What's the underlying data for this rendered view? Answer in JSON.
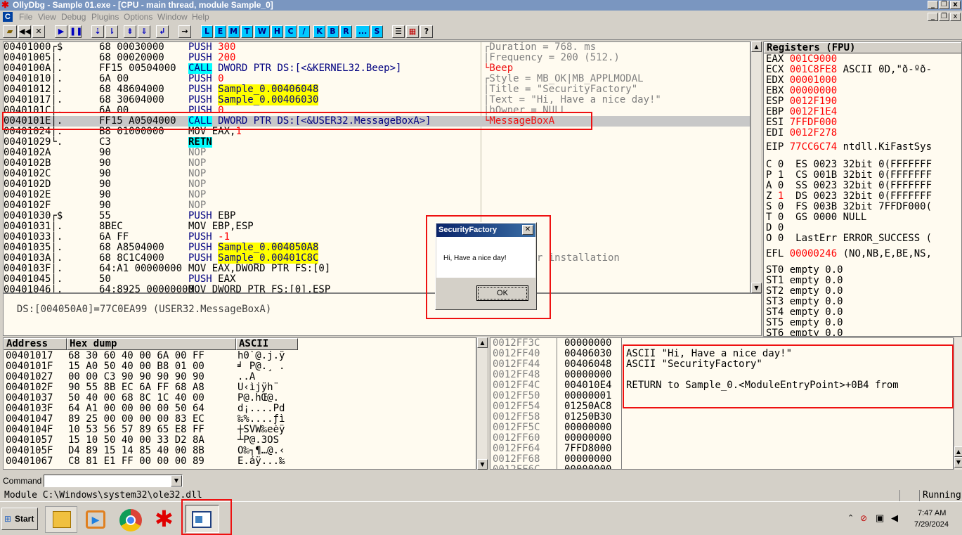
{
  "window": {
    "title": "OllyDbg - Sample 01.exe - [CPU - main thread, module Sample_0]"
  },
  "menu": [
    "File",
    "View",
    "Debug",
    "Plugins",
    "Options",
    "Window",
    "Help"
  ],
  "toolbar": {
    "letters": [
      "L",
      "E",
      "M",
      "T",
      "W",
      "H",
      "C",
      "/",
      "K",
      "B",
      "R",
      "...",
      "S"
    ]
  },
  "disasm": {
    "rows": [
      {
        "addr": "00401000",
        "mark": "┌$",
        "hex": "68 00030000",
        "op": "PUSH",
        "arg": "300",
        "style": "push"
      },
      {
        "addr": "00401005",
        "mark": "│.",
        "hex": "68 00020000",
        "op": "PUSH",
        "arg": "200",
        "style": "push"
      },
      {
        "addr": "0040100A",
        "mark": "│.",
        "hex": "FF15 00504000",
        "op": "CALL",
        "arg": "DWORD PTR DS:[<&KERNEL32.Beep>]",
        "style": "call"
      },
      {
        "addr": "00401010",
        "mark": "│.",
        "hex": "6A 00",
        "op": "PUSH",
        "arg": "0",
        "style": "push"
      },
      {
        "addr": "00401012",
        "mark": "│.",
        "hex": "68 48604000",
        "op": "PUSH",
        "arg": "Sample_0.00406048",
        "style": "pushy"
      },
      {
        "addr": "00401017",
        "mark": "│.",
        "hex": "68 30604000",
        "op": "PUSH",
        "arg": "Sample_0.00406030",
        "style": "pushy"
      },
      {
        "addr": "0040101C",
        "mark": "│.",
        "hex": "6A 00",
        "op": "PUSH",
        "arg": "0",
        "style": "push"
      },
      {
        "addr": "0040101E",
        "mark": "│.",
        "hex": "FF15 A0504000",
        "op": "CALL",
        "arg": "DWORD PTR DS:[<&USER32.MessageBoxA>]",
        "style": "callsel"
      },
      {
        "addr": "00401024",
        "mark": "│.",
        "hex": "B8 01000000",
        "op": "MOV EAX,",
        "arg": "1",
        "style": "mov"
      },
      {
        "addr": "00401029",
        "mark": "└.",
        "hex": "C3",
        "op": "RETN",
        "arg": "",
        "style": "retn"
      },
      {
        "addr": "0040102A",
        "mark": "",
        "hex": "90",
        "op": "NOP",
        "arg": "",
        "style": "nop"
      },
      {
        "addr": "0040102B",
        "mark": "",
        "hex": "90",
        "op": "NOP",
        "arg": "",
        "style": "nop"
      },
      {
        "addr": "0040102C",
        "mark": "",
        "hex": "90",
        "op": "NOP",
        "arg": "",
        "style": "nop"
      },
      {
        "addr": "0040102D",
        "mark": "",
        "hex": "90",
        "op": "NOP",
        "arg": "",
        "style": "nop"
      },
      {
        "addr": "0040102E",
        "mark": "",
        "hex": "90",
        "op": "NOP",
        "arg": "",
        "style": "nop"
      },
      {
        "addr": "0040102F",
        "mark": "",
        "hex": "90",
        "op": "NOP",
        "arg": "",
        "style": "nop"
      },
      {
        "addr": "00401030",
        "mark": "┌$",
        "hex": "55",
        "op": "PUSH",
        "arg": "EBP",
        "style": "pushplain"
      },
      {
        "addr": "00401031",
        "mark": "│.",
        "hex": "8BEC",
        "op": "MOV EBP,ESP",
        "arg": "",
        "style": "plain"
      },
      {
        "addr": "00401033",
        "mark": "│.",
        "hex": "6A FF",
        "op": "PUSH",
        "arg": "-1",
        "style": "push"
      },
      {
        "addr": "00401035",
        "mark": "│.",
        "hex": "68 A8504000",
        "op": "PUSH",
        "arg": "Sample_0.004050A8",
        "style": "pushy"
      },
      {
        "addr": "0040103A",
        "mark": "│.",
        "hex": "68 8C1C4000",
        "op": "PUSH",
        "arg": "Sample_0.00401C8C",
        "style": "pushy"
      },
      {
        "addr": "0040103F",
        "mark": "│.",
        "hex": "64:A1 00000000",
        "op": "MOV EAX,DWORD PTR FS:[0]",
        "arg": "",
        "style": "plain"
      },
      {
        "addr": "00401045",
        "mark": "│.",
        "hex": "50",
        "op": "PUSH",
        "arg": "EAX",
        "style": "pushplain"
      },
      {
        "addr": "00401046",
        "mark": "│.",
        "hex": "64:8925 00000000",
        "op": "MOV DWORD PTR FS:[0],ESP",
        "arg": "",
        "style": "plain"
      }
    ],
    "comments": [
      {
        "row": 0,
        "text": "┌Duration = 768. ms",
        "c": "gray"
      },
      {
        "row": 1,
        "text": "│Frequency = 200 (512.)",
        "c": "gray"
      },
      {
        "row": 2,
        "text": "└Beep",
        "c": "red"
      },
      {
        "row": 3,
        "text": "┌Style = MB_OK|MB_APPLMODAL",
        "c": "gray"
      },
      {
        "row": 4,
        "text": "│Title = \"SecurityFactory\"",
        "c": "gray"
      },
      {
        "row": 5,
        "text": "│Text = \"Hi, Have a nice day!\"",
        "c": "gray"
      },
      {
        "row": 6,
        "text": "│hOwner = NULL",
        "c": "gray"
      },
      {
        "row": 7,
        "text": "└MessageBoxA",
        "c": "red"
      },
      {
        "row": 20,
        "text": "SE handler installation",
        "c": "gray"
      }
    ],
    "info": "DS:[004050A0]=77C0EA99 (USER32.MessageBoxA)"
  },
  "registers": {
    "header": "Registers (FPU)",
    "gp": [
      {
        "n": "EAX",
        "v": "001C9000",
        "x": ""
      },
      {
        "n": "ECX",
        "v": "001C8FE8",
        "x": "ASCII 0D,\"ð-ºð-"
      },
      {
        "n": "EDX",
        "v": "00001000",
        "x": ""
      },
      {
        "n": "EBX",
        "v": "00000000",
        "x": ""
      },
      {
        "n": "ESP",
        "v": "0012F190",
        "x": ""
      },
      {
        "n": "EBP",
        "v": "0012F1E4",
        "x": ""
      },
      {
        "n": "ESI",
        "v": "7FFDF000",
        "x": ""
      },
      {
        "n": "EDI",
        "v": "0012F278",
        "x": ""
      }
    ],
    "eip": {
      "n": "EIP",
      "v": "77CC6C74",
      "x": "ntdll.KiFastSys"
    },
    "flags": [
      {
        "f": "C",
        "b": "0",
        "s": "ES 0023 32bit 0(FFFFFFF",
        "red": false
      },
      {
        "f": "P",
        "b": "1",
        "s": "CS 001B 32bit 0(FFFFFFF",
        "red": false
      },
      {
        "f": "A",
        "b": "0",
        "s": "SS 0023 32bit 0(FFFFFFF",
        "red": false
      },
      {
        "f": "Z",
        "b": "1",
        "s": "DS 0023 32bit 0(FFFFFFF",
        "red": true
      },
      {
        "f": "S",
        "b": "0",
        "s": "FS 003B 32bit 7FFDF000(",
        "red": false
      },
      {
        "f": "T",
        "b": "0",
        "s": "GS 0000 NULL",
        "red": false
      },
      {
        "f": "D",
        "b": "0",
        "s": "",
        "red": false
      },
      {
        "f": "O",
        "b": "0",
        "s": "LastErr ERROR_SUCCESS (",
        "red": false
      }
    ],
    "efl": {
      "n": "EFL",
      "v": "00000246",
      "x": "(NO,NB,E,BE,NS,"
    },
    "fpu": [
      "ST0 empty 0.0",
      "ST1 empty 0.0",
      "ST2 empty 0.0",
      "ST3 empty 0.0",
      "ST4 empty 0.0",
      "ST5 empty 0.0",
      "ST6 empty 0.0"
    ]
  },
  "dump": {
    "headers": {
      "address": "Address",
      "hex": "Hex dump",
      "ascii": "ASCII"
    },
    "rows": [
      {
        "a": "00401017",
        "h": "68 30 60 40 00 6A 00 FF",
        "s": "h0`@.j.ÿ"
      },
      {
        "a": "0040101F",
        "h": "15 A0 50 40 00 B8 01 00",
        "s": "╛ P@.¸ ."
      },
      {
        "a": "00401027",
        "h": "00 00 C3 90 90 90 90 90",
        "s": "..Ã"
      },
      {
        "a": "0040102F",
        "h": "90 55 8B EC 6A FF 68 A8",
        "s": "U‹ìjÿh¨"
      },
      {
        "a": "00401037",
        "h": "50 40 00 68 8C 1C 40 00",
        "s": "P@.hŒ@."
      },
      {
        "a": "0040103F",
        "h": "64 A1 00 00 00 00 50 64",
        "s": "d¡....Pd"
      },
      {
        "a": "00401047",
        "h": "89 25 00 00 00 00 83 EC",
        "s": "‰%....ƒì"
      },
      {
        "a": "0040104F",
        "h": "10 53 56 57 89 65 E8 FF",
        "s": "┼SVW‰eèÿ"
      },
      {
        "a": "00401057",
        "h": "15 10 50 40 00 33 D2 8A",
        "s": "┴P@.3ÒŠ"
      },
      {
        "a": "0040105F",
        "h": "D4 89 15 14 85 40 00 8B",
        "s": "Ô‰┐¶…@.‹"
      },
      {
        "a": "00401067",
        "h": "C8 81 E1 FF 00 00 00 89",
        "s": "È.áÿ...‰"
      }
    ]
  },
  "stack": {
    "rows": [
      {
        "a": "0012FF3C",
        "v": "00000000",
        "c": ""
      },
      {
        "a": "0012FF40",
        "v": "00406030",
        "c": "ASCII \"Hi, Have a nice day!\""
      },
      {
        "a": "0012FF44",
        "v": "00406048",
        "c": "ASCII \"SecurityFactory\""
      },
      {
        "a": "0012FF48",
        "v": "00000000",
        "c": ""
      },
      {
        "a": "0012FF4C",
        "v": "004010E4",
        "c": "RETURN to Sample_0.<ModuleEntryPoint>+0B4 from"
      },
      {
        "a": "0012FF50",
        "v": "00000001",
        "c": ""
      },
      {
        "a": "0012FF54",
        "v": "01250AC8",
        "c": ""
      },
      {
        "a": "0012FF58",
        "v": "01250B30",
        "c": ""
      },
      {
        "a": "0012FF5C",
        "v": "00000000",
        "c": ""
      },
      {
        "a": "0012FF60",
        "v": "00000000",
        "c": ""
      },
      {
        "a": "0012FF64",
        "v": "7FFD8000",
        "c": ""
      },
      {
        "a": "0012FF68",
        "v": "00000000",
        "c": ""
      },
      {
        "a": "0012FF6C",
        "v": "00000000",
        "c": ""
      }
    ]
  },
  "dialog": {
    "title": "SecurityFactory",
    "message": "Hi, Have a nice day!",
    "ok": "OK"
  },
  "command": {
    "label": "Command :",
    "value": ""
  },
  "status": {
    "module": "Module C:\\Windows\\system32\\ole32.dll",
    "state": "Running"
  },
  "taskbar": {
    "start": "Start",
    "time": "7:47 AM",
    "date": "7/29/2024"
  },
  "colors": {
    "highlight": "#ffff00",
    "call": "#00ffff",
    "annotation": "#ee1111",
    "selected": "#c8c8c8"
  }
}
